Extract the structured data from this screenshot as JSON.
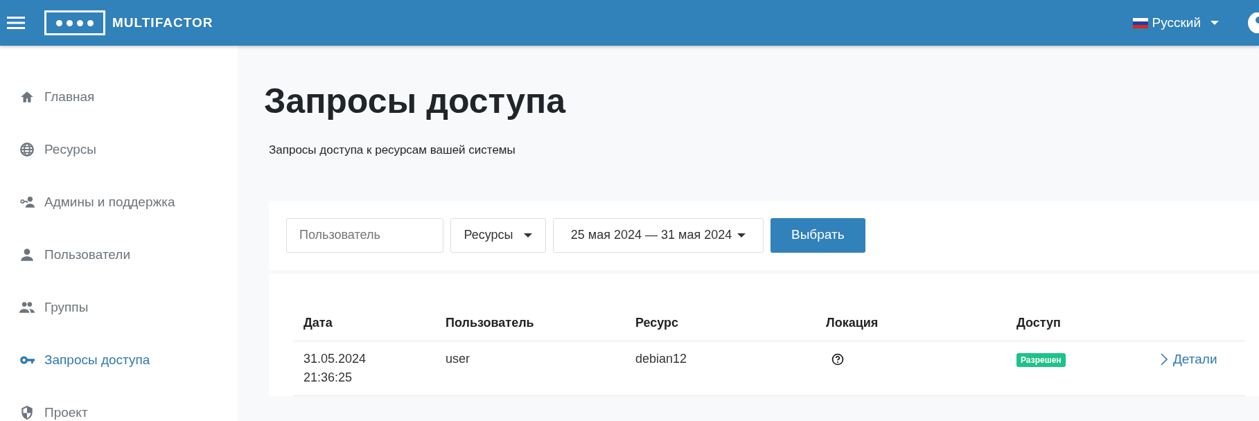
{
  "header": {
    "logo_text": "MULTIFACTOR",
    "language": "Русский"
  },
  "sidebar": {
    "items": [
      {
        "label": "Главная",
        "selected": false
      },
      {
        "label": "Ресурсы",
        "selected": false
      },
      {
        "label": "Админы и поддержка",
        "selected": false
      },
      {
        "label": "Пользователи",
        "selected": false
      },
      {
        "label": "Группы",
        "selected": false
      },
      {
        "label": "Запросы доступа",
        "selected": true
      },
      {
        "label": "Проект",
        "selected": false
      }
    ]
  },
  "page": {
    "title": "Запросы доступа",
    "subtitle": "Запросы доступа к ресурсам вашей системы"
  },
  "filters": {
    "user": {
      "placeholder": "Пользователь"
    },
    "resources": "Ресурсы",
    "date_range": "25 мая 2024 — 31 мая 2024",
    "submit": "Выбрать"
  },
  "table": {
    "columns": [
      "Дата",
      "Пользователь",
      "Ресурс",
      "Локация",
      "Доступ"
    ],
    "rows": [
      {
        "date": "31.05.2024",
        "time": "21:36:25",
        "user": "user",
        "resource": "debian12",
        "access": "Разрешен",
        "details": "Детали"
      }
    ]
  }
}
